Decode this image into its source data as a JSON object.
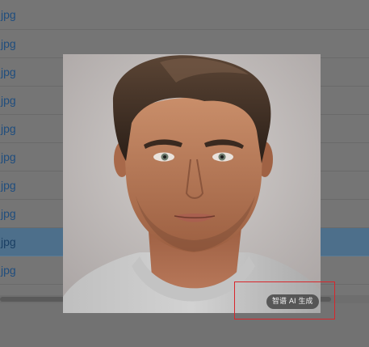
{
  "files": [
    {
      "name": "jpg",
      "selected": false
    },
    {
      "name": "jpg",
      "selected": false
    },
    {
      "name": "jpg",
      "selected": false
    },
    {
      "name": "jpg",
      "selected": false
    },
    {
      "name": "jpg",
      "selected": false
    },
    {
      "name": "jpg",
      "selected": false
    },
    {
      "name": "jpg",
      "selected": false
    },
    {
      "name": "jpg",
      "selected": false
    },
    {
      "name": "jpg",
      "selected": true
    },
    {
      "name": "jpg",
      "selected": false
    }
  ],
  "preview": {
    "watermark": "智谱 AI 生成",
    "image_icon": "portrait-image"
  },
  "colors": {
    "highlight": "#d8262b",
    "selected_row": "#4d6f8b",
    "link_text": "#1f4d7e"
  }
}
